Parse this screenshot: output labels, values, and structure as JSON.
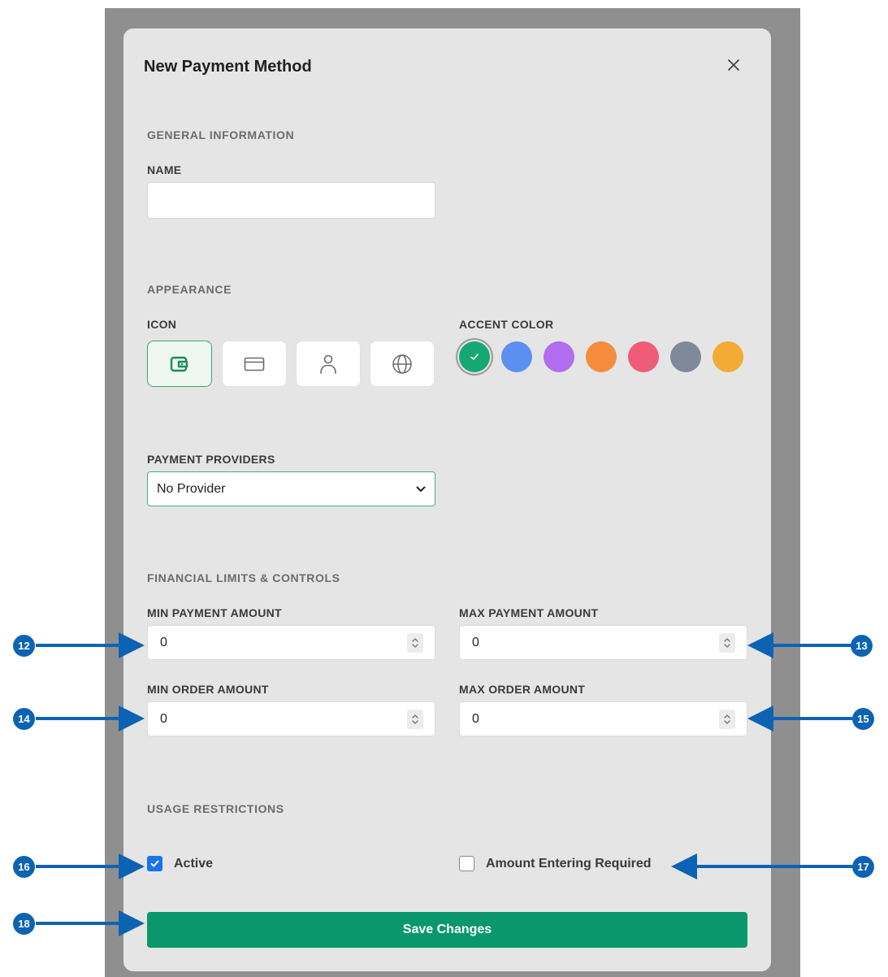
{
  "modal": {
    "title": "New Payment Method",
    "close_icon": "close-icon"
  },
  "general": {
    "section_title": "GENERAL INFORMATION",
    "name_label": "NAME",
    "name_value": ""
  },
  "appearance": {
    "section_title": "APPEARANCE",
    "icon_label": "ICON",
    "icons": [
      "wallet-icon",
      "credit-card-icon",
      "user-icon",
      "globe-icon"
    ],
    "selected_icon": "wallet-icon",
    "accent_label": "ACCENT COLOR",
    "colors": [
      "#16a874",
      "#5b8ff0",
      "#b16cf0",
      "#f58b3c",
      "#ef5c78",
      "#7e8a9a",
      "#f4ab33"
    ],
    "selected_color": "#16a874"
  },
  "providers": {
    "label": "PAYMENT PROVIDERS",
    "selected": "No Provider"
  },
  "limits": {
    "section_title": "FINANCIAL LIMITS & CONTROLS",
    "min_payment_label": "MIN PAYMENT AMOUNT",
    "min_payment_value": "0",
    "max_payment_label": "MAX PAYMENT AMOUNT",
    "max_payment_value": "0",
    "min_order_label": "MIN ORDER AMOUNT",
    "min_order_value": "0",
    "max_order_label": "MAX ORDER AMOUNT",
    "max_order_value": "0"
  },
  "usage": {
    "section_title": "USAGE RESTRICTIONS",
    "active_label": "Active",
    "active_checked": true,
    "amount_required_label": "Amount Entering Required",
    "amount_required_checked": false
  },
  "save_label": "Save Changes",
  "callouts": [
    "12",
    "13",
    "14",
    "15",
    "16",
    "17",
    "18"
  ],
  "annotation_color": "#0d63b3"
}
